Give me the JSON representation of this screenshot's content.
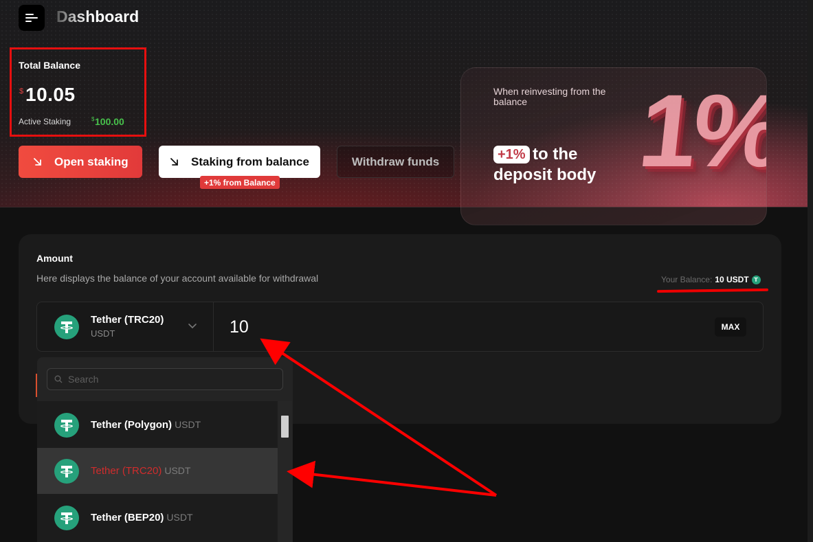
{
  "header": {
    "title": "Dashboard",
    "menu_icon": "menu-icon"
  },
  "balance": {
    "label": "Total Balance",
    "currency_symbol": "$",
    "value": "10.05",
    "active_label": "Active Staking",
    "active_currency_symbol": "$",
    "active_value": "100.00"
  },
  "actions": {
    "open_staking": "Open staking",
    "staking_from_balance": "Staking from balance",
    "staking_badge": "+1% from Balance",
    "withdraw": "Withdraw funds"
  },
  "promo": {
    "small_text": "When reinvesting from the balance",
    "big_figure": "1%",
    "pill": "+1%",
    "line1": "to the",
    "line2": "deposit body"
  },
  "amount": {
    "title": "Amount",
    "description": "Here displays the balance of your account available for withdrawal",
    "your_balance_label": "Your Balance:",
    "your_balance_value": "10 USDT",
    "selected_coin": {
      "name": "Tether (TRC20)",
      "symbol": "USDT"
    },
    "input_value": "10",
    "max_label": "MAX"
  },
  "dropdown": {
    "search_placeholder": "Search",
    "options": [
      {
        "name": "Tether (Polygon)",
        "symbol": "USDT",
        "selected": false
      },
      {
        "name": "Tether (TRC20)",
        "symbol": "USDT",
        "selected": true
      },
      {
        "name": "Tether (BEP20)",
        "symbol": "USDT",
        "selected": false
      }
    ]
  },
  "colors": {
    "accent_red": "#e23a3a",
    "positive_green": "#48c14c",
    "tether_green": "#26a17b",
    "annotation_red": "#ff0000"
  }
}
